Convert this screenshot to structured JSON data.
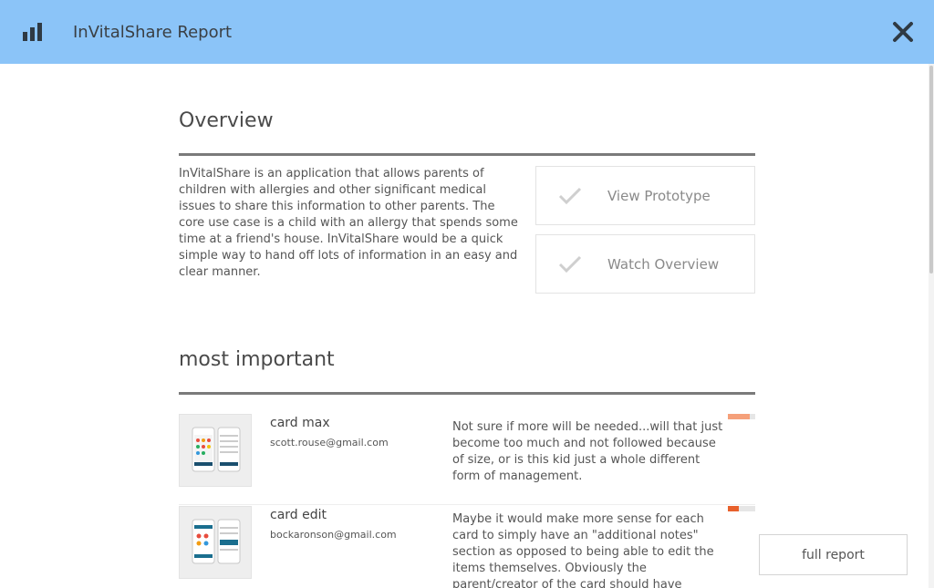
{
  "header": {
    "title": "InVitalShare Report",
    "logo_icon": "bar-chart-icon",
    "close_icon": "close-icon",
    "background": "#8bc4f8"
  },
  "overview": {
    "title": "Overview",
    "description": "InVitalShare is an application that allows parents of children with allergies and other significant medical issues to share this information to other parents. The core use case is a child with an allergy that spends some time at a friend's house. InVitalShare would be a quick simple way to hand off lots of information in an easy and clear manner.",
    "actions": [
      {
        "label": "View Prototype",
        "icon": "check-icon"
      },
      {
        "label": "Watch Overview",
        "icon": "check-icon"
      }
    ]
  },
  "most_important": {
    "title": "most important",
    "items": [
      {
        "name": "card max",
        "email": "scott.rouse@gmail.com",
        "comment": "Not sure if more will be needed...will that just become too much and not followed because of size, or is this kid just a whole different form of management.",
        "priority": 0.8,
        "priority_color": "#f5a07a"
      },
      {
        "name": "card edit",
        "email": "bockaronson@gmail.com",
        "comment": "Maybe it would make more sense for each card to simply have an \"additional notes\" section as opposed to being able to edit the items themselves. Obviously the parent/creator of the card should have editing, but the use case",
        "priority": 0.4,
        "priority_color": "#e8612c"
      }
    ]
  },
  "footer": {
    "full_report_label": "full report"
  }
}
